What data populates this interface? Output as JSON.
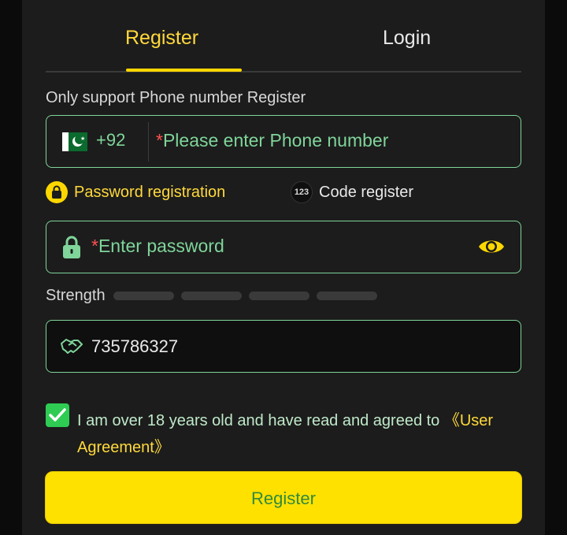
{
  "tabs": {
    "register": "Register",
    "login": "Login"
  },
  "support_text": "Only support Phone number Register",
  "phone": {
    "country_code": "+92",
    "required_mark": "*",
    "placeholder": "Please enter Phone number"
  },
  "modes": {
    "password": "Password registration",
    "code_badge": "123",
    "code": "Code register"
  },
  "password": {
    "required_mark": "*",
    "placeholder": "Enter password"
  },
  "strength": {
    "label": "Strength",
    "level": 0,
    "bars": 4
  },
  "invite": {
    "value": "735786327"
  },
  "agreement": {
    "checked": true,
    "text": "I am over 18 years old and have read and agreed to ",
    "link": "《User Agreement》"
  },
  "register_button": "Register",
  "colors": {
    "accent": "#ffd700",
    "field_border": "#7fd59a",
    "check": "#2ecc53",
    "required": "#ff5252"
  }
}
